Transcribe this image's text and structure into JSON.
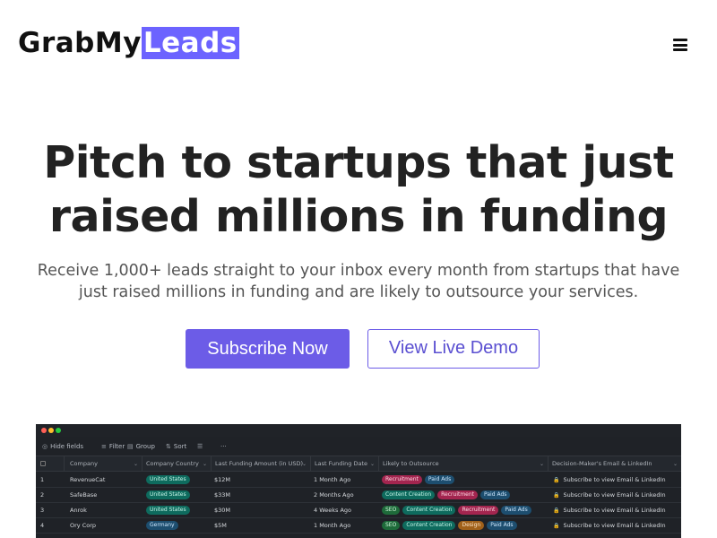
{
  "header": {
    "logo_part1": "GrabMy",
    "logo_part2": "Leads",
    "menu_icon": "hamburger-menu-icon",
    "accent_color": "#6c63ff"
  },
  "hero": {
    "title_line1": "Pitch to startups that just",
    "title_line2_plain": "raised ",
    "title_line2_underlined": "millions in funding",
    "subtitle": "Receive 1,000+ leads straight to your inbox every month from startups that have just raised millions in funding and are likely to outsource your services."
  },
  "cta": {
    "primary_label": "Subscribe Now",
    "secondary_label": "View Live Demo",
    "button_color": "#6c5ce7"
  },
  "preview": {
    "toolbar": {
      "hide_fields": "Hide fields",
      "filter": "Filter",
      "group": "Group",
      "sort": "Sort",
      "more": "···"
    },
    "columns": [
      "Company",
      "Company Country",
      "Last Funding Amount (in USD)",
      "Last Funding Date",
      "Likely to Outsource",
      "Decision-Maker's Email & LinkedIn"
    ],
    "rows": [
      {
        "num": "1",
        "company": "RevenueCat",
        "country": "United States",
        "amount": "$12M",
        "date": "1 Month Ago",
        "outsource": [
          {
            "label": "Recruitment",
            "color": "pink"
          },
          {
            "label": "Paid Ads",
            "color": "blue"
          }
        ],
        "email": "Subscribe to view Email & LinkedIn"
      },
      {
        "num": "2",
        "company": "SafeBase",
        "country": "United States",
        "amount": "$33M",
        "date": "2 Months Ago",
        "outsource": [
          {
            "label": "Content Creation",
            "color": "teal"
          },
          {
            "label": "Recruitment",
            "color": "pink"
          },
          {
            "label": "Paid Ads",
            "color": "blue"
          }
        ],
        "email": "Subscribe to view Email & LinkedIn"
      },
      {
        "num": "3",
        "company": "Anrok",
        "country": "United States",
        "amount": "$30M",
        "date": "4 Weeks Ago",
        "outsource": [
          {
            "label": "SEO",
            "color": "green"
          },
          {
            "label": "Content Creation",
            "color": "teal"
          },
          {
            "label": "Recruitment",
            "color": "pink"
          },
          {
            "label": "Paid Ads",
            "color": "blue"
          }
        ],
        "email": "Subscribe to view Email & LinkedIn"
      },
      {
        "num": "4",
        "company": "Ory Corp",
        "country": "Germany",
        "amount": "$5M",
        "date": "1 Month Ago",
        "outsource": [
          {
            "label": "SEO",
            "color": "green"
          },
          {
            "label": "Content Creation",
            "color": "teal"
          },
          {
            "label": "Design",
            "color": "orange"
          },
          {
            "label": "Paid Ads",
            "color": "blue"
          }
        ],
        "email": "Subscribe to view Email & LinkedIn"
      }
    ]
  }
}
